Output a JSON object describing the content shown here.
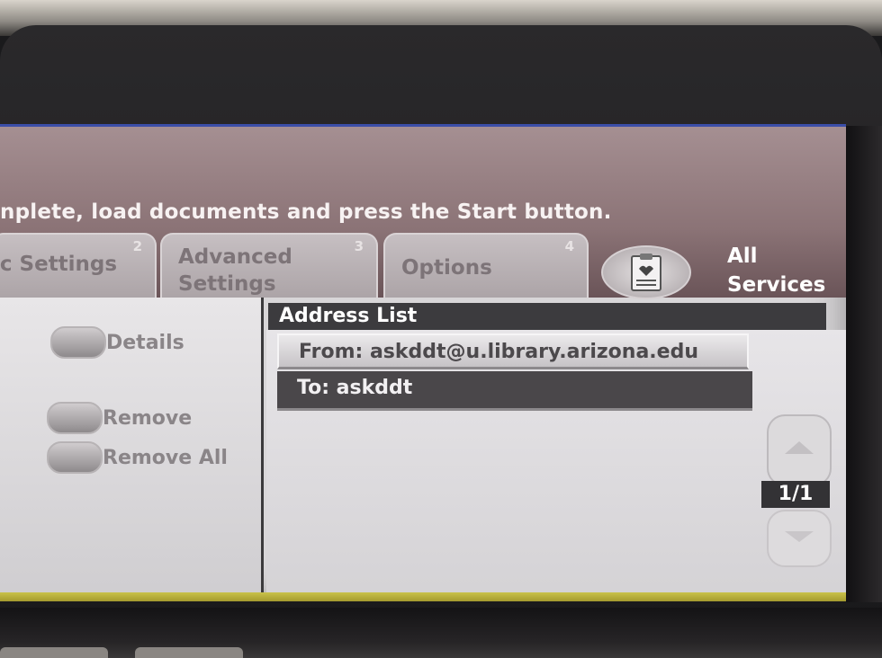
{
  "header": {
    "instruction": "nplete, load documents and press the Start button."
  },
  "tabs": [
    {
      "number": "2",
      "label": "ic Settings"
    },
    {
      "number": "3",
      "label_line1": "Advanced",
      "label_line2": "Settings"
    },
    {
      "number": "4",
      "label": "Options"
    }
  ],
  "all_services": {
    "line1": "All",
    "line2": "Services"
  },
  "left_panel": {
    "details": "Details",
    "remove": "Remove",
    "remove_all": "Remove All"
  },
  "address_list": {
    "title": "Address List",
    "rows": [
      {
        "text": "From: askddt@u.library.arizona.edu",
        "selected": false
      },
      {
        "text": "To: askddt",
        "selected": true
      }
    ],
    "page_indicator": "1/1"
  },
  "colors": {
    "header": "#8b7376",
    "selected_row": "#4a474a",
    "screen_border": "#3b4ea8"
  }
}
